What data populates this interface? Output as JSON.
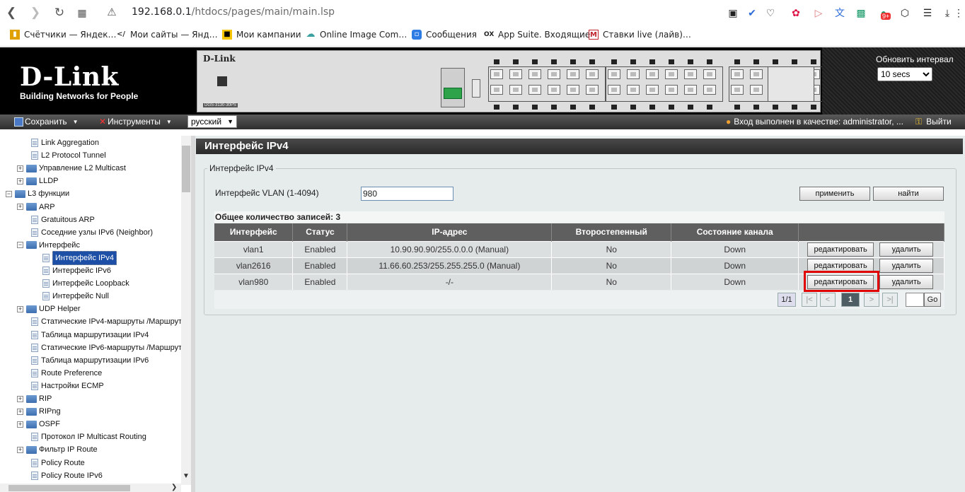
{
  "browser": {
    "url_host": "192.168.0.1",
    "url_path": "/htdocs/pages/main/main.lsp",
    "bookmarks": [
      {
        "label": "Счётчики — Яндек…",
        "icon": "bar-chart-icon",
        "color": "#e0a100"
      },
      {
        "label": "Мои сайты — Янд…",
        "icon": "code-icon",
        "color": "#333333"
      },
      {
        "label": "Мои кампании",
        "icon": "yandex-direct-icon",
        "color": "#f5c400"
      },
      {
        "label": "Online Image Com…",
        "icon": "cloud-icon",
        "color": "#3aa0a0"
      },
      {
        "label": "Сообщения",
        "icon": "chat-icon",
        "color": "#2d7be5"
      },
      {
        "label": "App Suite. Входящие",
        "icon": "ox-icon",
        "color": "#222222"
      },
      {
        "label": "Ставки live (лайв)…",
        "icon": "m-icon",
        "color": "#c0242c"
      }
    ],
    "badge": "9+"
  },
  "device": {
    "logo": "D-Link",
    "tagline": "Building Networks for People",
    "panel_brand": "D-Link",
    "model": "DGS-3130-30PS",
    "refresh_label": "Обновить интервал",
    "refresh_value": "10 secs"
  },
  "menubar": {
    "save": "Сохранить",
    "tools": "Инструменты",
    "language": "русский",
    "login": "Вход выполнен в качестве: administrator, ...",
    "logout": "Выйти"
  },
  "tree": [
    {
      "label": "Link Aggregation",
      "type": "page",
      "level": 2
    },
    {
      "label": "L2 Protocol Tunnel",
      "type": "page",
      "level": 2
    },
    {
      "label": "Управление L2 Multicast",
      "type": "folder",
      "level": 1
    },
    {
      "label": "LLDP",
      "type": "folder",
      "level": 1
    },
    {
      "label": "L3 функции",
      "type": "folder-open",
      "level": 0
    },
    {
      "label": "ARP",
      "type": "folder",
      "level": 1
    },
    {
      "label": "Gratuitous ARP",
      "type": "page",
      "level": 2
    },
    {
      "label": "Соседние узлы IPv6 (Neighbor)",
      "type": "page",
      "level": 2
    },
    {
      "label": "Интерфейс",
      "type": "folder-open",
      "level": 1
    },
    {
      "label": "Интерфейс IPv4",
      "type": "page",
      "level": 3,
      "selected": true
    },
    {
      "label": "Интерфейс IPv6",
      "type": "page",
      "level": 3
    },
    {
      "label": "Интерфейс Loopback",
      "type": "page",
      "level": 3
    },
    {
      "label": "Интерфейс Null",
      "type": "page",
      "level": 3
    },
    {
      "label": "UDP Helper",
      "type": "folder",
      "level": 1
    },
    {
      "label": "Статические IPv4-маршруты /Маршрут",
      "type": "page",
      "level": 2
    },
    {
      "label": "Таблица маршрутизации IPv4",
      "type": "page",
      "level": 2
    },
    {
      "label": "Статические IPv6-маршруты /Маршрут",
      "type": "page",
      "level": 2
    },
    {
      "label": "Таблица маршрутизации IPv6",
      "type": "page",
      "level": 2
    },
    {
      "label": "Route Preference",
      "type": "page",
      "level": 2
    },
    {
      "label": "Настройки ECMP",
      "type": "page",
      "level": 2
    },
    {
      "label": "RIP",
      "type": "folder",
      "level": 1
    },
    {
      "label": "RIPng",
      "type": "folder",
      "level": 1
    },
    {
      "label": "OSPF",
      "type": "folder",
      "level": 1
    },
    {
      "label": "Протокол IP Multicast Routing",
      "type": "page",
      "level": 2
    },
    {
      "label": "Фильтр IP Route",
      "type": "folder",
      "level": 1
    },
    {
      "label": "Policy Route",
      "type": "page",
      "level": 2
    },
    {
      "label": "Policy Route IPv6",
      "type": "page",
      "level": 2
    }
  ],
  "page": {
    "title": "Интерфейс IPv4",
    "fieldset": "Интерфейс IPv4",
    "vlan_label": "Интерфейс VLAN  (1-4094)",
    "vlan_value": "980",
    "apply": "применить",
    "find": "найти",
    "total": "Общее количество записей: 3",
    "columns": [
      "Интерфейс",
      "Статус",
      "IP-адрес",
      "Второстепенный",
      "Состояние канала",
      ""
    ],
    "rows": [
      {
        "iface": "vlan1",
        "status": "Enabled",
        "ip": "10.90.90.90/255.0.0.0 (Manual)",
        "secondary": "No",
        "link": "Down",
        "edit": "редактировать",
        "del": "удалить"
      },
      {
        "iface": "vlan2616",
        "status": "Enabled",
        "ip": "11.66.60.253/255.255.255.0 (Manual)",
        "secondary": "No",
        "link": "Down",
        "edit": "редактировать",
        "del": "удалить"
      },
      {
        "iface": "vlan980",
        "status": "Enabled",
        "ip": "-/-",
        "secondary": "No",
        "link": "Down",
        "edit": "редактировать",
        "del": "удалить"
      }
    ],
    "pager": {
      "pages": "1/1",
      "first": "|<",
      "prev": "<",
      "current": "1",
      "next": ">",
      "last": ">|",
      "go": "Go"
    },
    "highlight_color": "#e00000"
  }
}
